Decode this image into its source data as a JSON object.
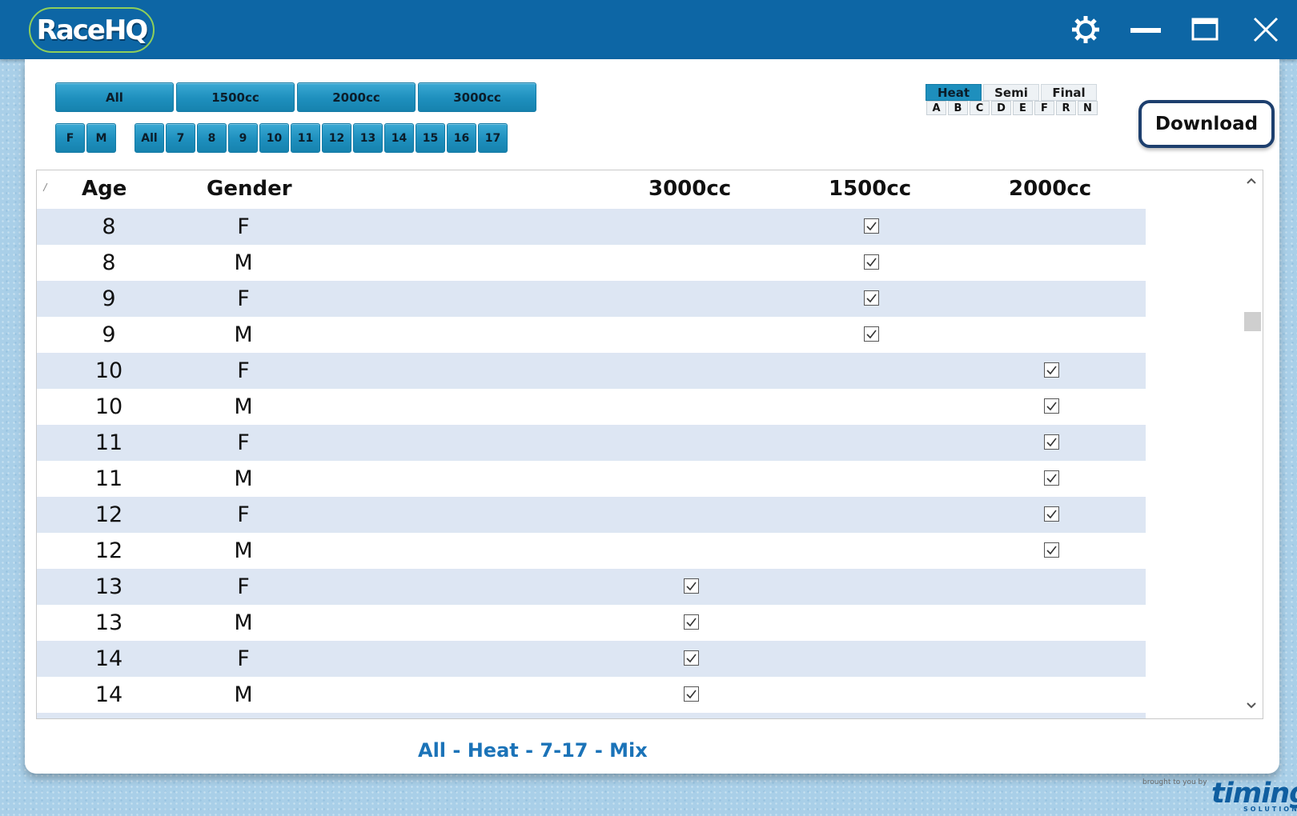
{
  "app": {
    "logo_text": "RaceHQ"
  },
  "window_controls": [
    "gear-icon",
    "minimize-icon",
    "maximize-icon",
    "close-icon"
  ],
  "class_filters": [
    "All",
    "1500cc",
    "2000cc",
    "3000cc"
  ],
  "gender_filters": [
    "F",
    "M"
  ],
  "age_filters": [
    "All",
    "7",
    "8",
    "9",
    "10",
    "11",
    "12",
    "13",
    "14",
    "15",
    "16",
    "17"
  ],
  "race_types": [
    "Heat",
    "Semi",
    "Final"
  ],
  "race_types_active": "Heat",
  "race_letters": [
    "A",
    "B",
    "C",
    "D",
    "E",
    "F",
    "R",
    "N"
  ],
  "download_label": "Download",
  "table": {
    "columns": [
      "Age",
      "Gender",
      "3000cc",
      "1500cc",
      "2000cc"
    ],
    "rows": [
      {
        "age": "8",
        "gender": "F",
        "checked": "1500cc"
      },
      {
        "age": "8",
        "gender": "M",
        "checked": "1500cc"
      },
      {
        "age": "9",
        "gender": "F",
        "checked": "1500cc"
      },
      {
        "age": "9",
        "gender": "M",
        "checked": "1500cc"
      },
      {
        "age": "10",
        "gender": "F",
        "checked": "2000cc"
      },
      {
        "age": "10",
        "gender": "M",
        "checked": "2000cc"
      },
      {
        "age": "11",
        "gender": "F",
        "checked": "2000cc"
      },
      {
        "age": "11",
        "gender": "M",
        "checked": "2000cc"
      },
      {
        "age": "12",
        "gender": "F",
        "checked": "2000cc"
      },
      {
        "age": "12",
        "gender": "M",
        "checked": "2000cc"
      },
      {
        "age": "13",
        "gender": "F",
        "checked": "3000cc"
      },
      {
        "age": "13",
        "gender": "M",
        "checked": "3000cc"
      },
      {
        "age": "14",
        "gender": "F",
        "checked": "3000cc"
      },
      {
        "age": "14",
        "gender": "M",
        "checked": "3000cc"
      }
    ]
  },
  "footer": {
    "caption": "All - Heat - 7-17 - Mix",
    "brand_small": "brought to you by",
    "brand_name": "timing",
    "brand_sub": "SOLUTIONS"
  },
  "colors": {
    "titlebar": "#0d66a5",
    "button": "#1e8fbd",
    "row_alt": "#dde6f3",
    "caption": "#1b73b8"
  }
}
